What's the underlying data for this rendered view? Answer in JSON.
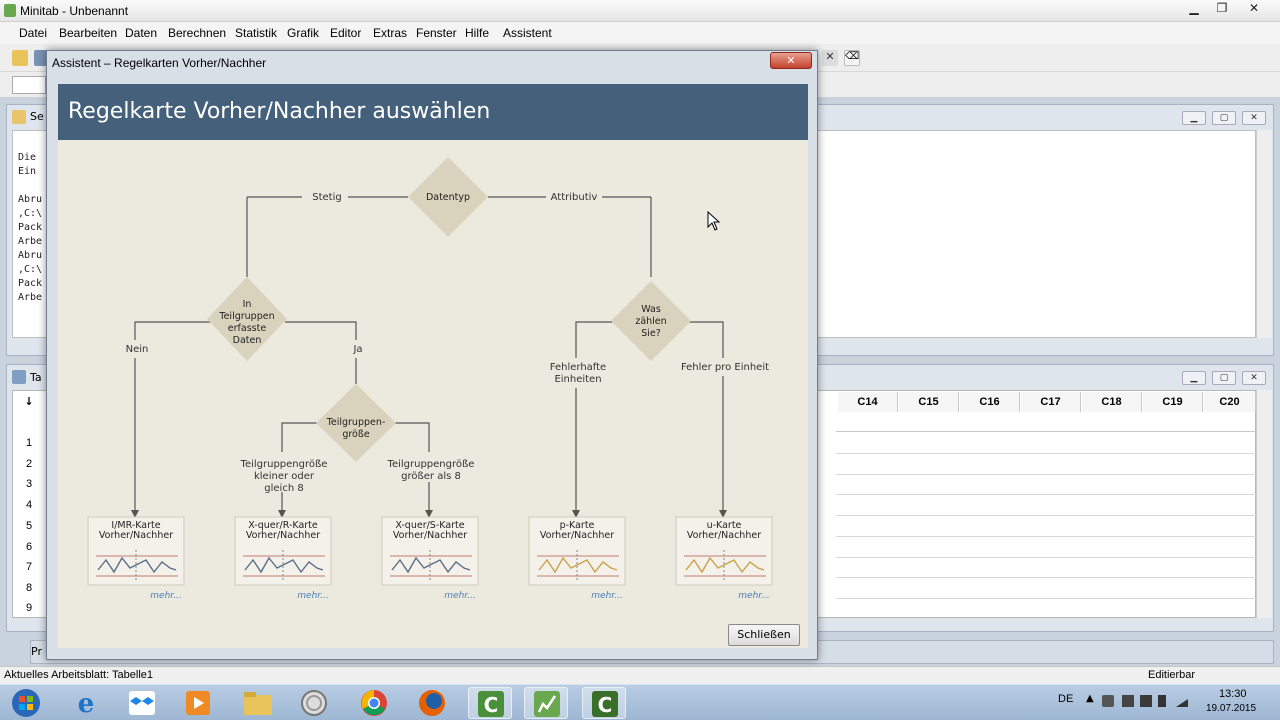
{
  "window": {
    "title": "Minitab - Unbenannt"
  },
  "menubar": {
    "items": [
      "Datei",
      "Bearbeiten",
      "Daten",
      "Berechnen",
      "Statistik",
      "Grafik",
      "Editor",
      "Extras",
      "Fenster",
      "Hilfe",
      "Assistent"
    ]
  },
  "session": {
    "title": "Se",
    "lines": [
      "Die",
      "Ein",
      "Abru",
      ",C:\\",
      "Pack",
      "Arbe",
      "Abru",
      ",C:\\",
      "Pack",
      "Arbe"
    ]
  },
  "worksheet": {
    "title": "Ta",
    "columns": [
      "C14",
      "C15",
      "C16",
      "C17",
      "C18",
      "C19",
      "C20"
    ],
    "rows": [
      "1",
      "2",
      "3",
      "4",
      "5",
      "6",
      "7",
      "8",
      "9"
    ],
    "row_arrow": "↓"
  },
  "minimized": {
    "label": "Pr"
  },
  "dialog": {
    "title": "Assistent – Regelkarten Vorher/Nachher",
    "close_symbol": "✕",
    "heading": "Regelkarte Vorher/Nachher auswählen",
    "close_button": "Schließen",
    "flow": {
      "datentyp": "Datentyp",
      "stetig": "Stetig",
      "attributiv": "Attributiv",
      "teilgruppen": [
        "In",
        "Teilgruppen",
        "erfasste",
        "Daten"
      ],
      "nein": "Nein",
      "ja": "Ja",
      "groesse": [
        "Teilgruppen-",
        "größe"
      ],
      "klein": [
        "Teilgruppengröße",
        "kleiner oder",
        "gleich 8"
      ],
      "gross": [
        "Teilgruppengröße",
        "größer als 8"
      ],
      "was": [
        "Was",
        "zählen",
        "Sie?"
      ],
      "fehlerhafte": [
        "Fehlerhafte",
        "Einheiten"
      ],
      "fehler_pro": "Fehler pro Einheit",
      "cards": [
        {
          "line1": "I/MR-Karte",
          "line2": "Vorher/Nachher",
          "more": "mehr..."
        },
        {
          "line1": "X-quer/R-Karte",
          "line2": "Vorher/Nachher",
          "more": "mehr..."
        },
        {
          "line1": "X-quer/S-Karte",
          "line2": "Vorher/Nachher",
          "more": "mehr..."
        },
        {
          "line1": "p-Karte",
          "line2": "Vorher/Nachher",
          "more": "mehr..."
        },
        {
          "line1": "u-Karte",
          "line2": "Vorher/Nachher",
          "more": "mehr..."
        }
      ]
    }
  },
  "statusbar": {
    "left": "Aktuelles Arbeitsblatt: Tabelle1",
    "right": "Editierbar"
  },
  "taskbar": {
    "lang": "DE",
    "time": "13:30",
    "date": "19.07.2015",
    "apps": [
      "start-icon",
      "ie-icon",
      "dropbox-icon",
      "media-icon",
      "explorer-icon",
      "circle-app-icon",
      "chrome-icon",
      "firefox-icon",
      "camtasia-icon",
      "minitab-icon",
      "camtasia-recorder-icon"
    ]
  },
  "colors": {
    "accent": "#45607a",
    "diamond": "#d9d2bd",
    "content_bg": "#ece9df",
    "chart_line_blue": "#5a6f86",
    "chart_line_gold": "#c9a24a",
    "chart_limit": "#c07a6e"
  }
}
